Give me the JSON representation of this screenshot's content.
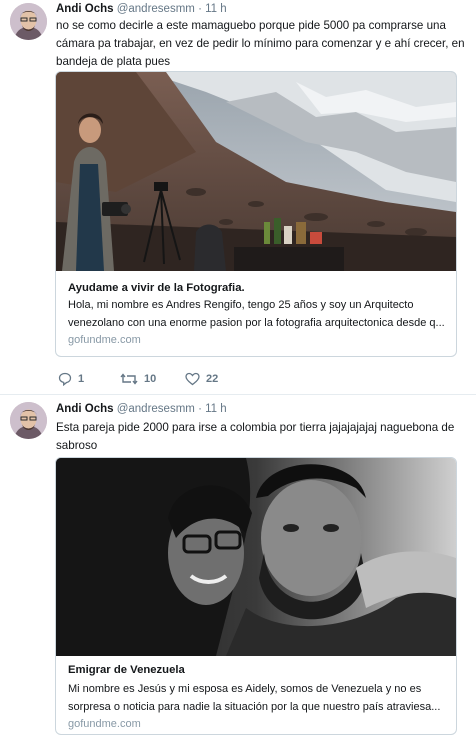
{
  "tweets": [
    {
      "name": "Andi Ochs",
      "handle": "@andresesmm",
      "separator": "·",
      "time": "11 h",
      "text": "no se como decirle a este mamaguebo porque pide 5000 pa comprarse una cámara pa trabajar, en vez de pedir lo mínimo para comenzar y e ahí crecer, en bandeja de plata pues",
      "card": {
        "title": "Ayudame a vivir de la Fotografia.",
        "description": "Hola, mi nombre es Andres Rengifo, tengo 25 años y soy un Arquitecto venezolano con una enorme pasion por la fotografia arquitectonica desde q...",
        "domain": "gofundme.com"
      },
      "actions": {
        "replies": "1",
        "retweets": "10",
        "likes": "22"
      }
    },
    {
      "name": "Andi Ochs",
      "handle": "@andresesmm",
      "separator": "·",
      "time": "11 h",
      "text": "Esta pareja pide 2000 para irse a colombia por tierra jajajajajaj naguebona de sabroso",
      "card": {
        "title": "Emigrar de Venezuela",
        "description": "Mi nombre es Jesús y mi esposa es Aidely, somos de Venezuela y no es sorpresa o noticia para nadie la situación por la que nuestro país atraviesa...",
        "domain": "gofundme.com"
      }
    }
  ],
  "colors": {
    "text": "#14171a",
    "secondary": "#657786",
    "border": "#ccd6dd",
    "divider": "#e6ecf0"
  },
  "icons": [
    "reply-icon",
    "retweet-icon",
    "like-icon"
  ]
}
